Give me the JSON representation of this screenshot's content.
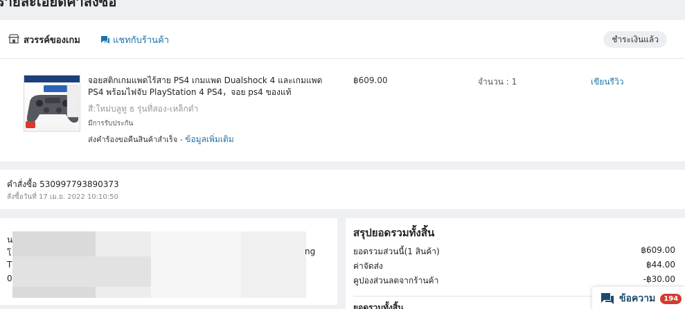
{
  "page": {
    "title": "รายละเอียดคำสั่งซื้อ"
  },
  "shop": {
    "name": "สวรรค์ของเกม",
    "chat_label": "แชทกับร้านค้า",
    "status": "ชำระเงินแล้ว"
  },
  "product": {
    "name": "จอยสติกเกมแพดไร้สาย PS4 เกมแพด Dualshock 4 และเกมแพด PS4 พร้อมไฟจับ PlayStation 4 PS4，จอย ps4 ของแท้",
    "variant": "สี:ใหม่บลูทู ธ รุ่นที่สอง-เหล็กดำ",
    "warranty": "มีการรับประกัน",
    "return_text": "ส่งคำร้องขอคืนสินค้าสำเร็จ - ",
    "return_link": "ข้อมูลเพิ่มเติม",
    "price": "฿609.00",
    "quantity": "จำนวน :  1",
    "review_label": "เขียนรีวิว"
  },
  "order": {
    "id": "คำสั่งซื้อ 530997793890373",
    "date": "สั่งซื้อวันที่ 17 เม.ย. 2022 10:10:50"
  },
  "address": {
    "line1": "น",
    "line2": "โ",
    "line2_tail": "ng",
    "line3": "T",
    "line4": "0"
  },
  "summary": {
    "title": "สรุปยอดรวมทั้งสิ้น",
    "rows": [
      {
        "label": "ยอดรวมส่วนนี้(1 สินค้า)",
        "value": "฿609.00"
      },
      {
        "label": "ค่าจัดส่ง",
        "value": "฿44.00"
      },
      {
        "label": "คูปองส่วนลดจากร้านค้า",
        "value": "-฿30.00"
      }
    ],
    "total_label": "ยอดรวมทั้งสิ้น"
  },
  "messages": {
    "label": "ข้อความ",
    "count": "194"
  },
  "colors": {
    "accent": "#1a73a8",
    "badge_red": "#d43a2e",
    "page_bg": "#eef0f4"
  }
}
